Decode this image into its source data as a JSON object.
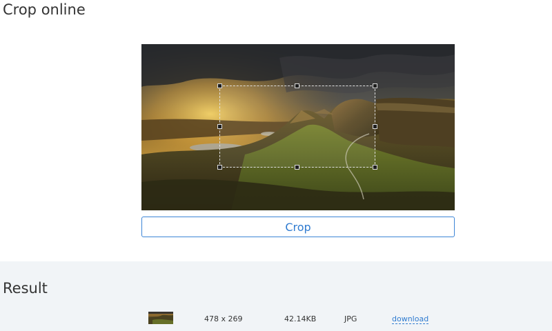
{
  "page": {
    "title": "Crop online"
  },
  "editor": {
    "crop_button_label": "Crop"
  },
  "result": {
    "title": "Result",
    "dimensions": "478 x 269",
    "file_size": "42.14KB",
    "format": "JPG",
    "download_label": "download"
  },
  "colors": {
    "accent": "#2f7bd0",
    "result_background": "#f1f4f7",
    "text": "#333333"
  }
}
